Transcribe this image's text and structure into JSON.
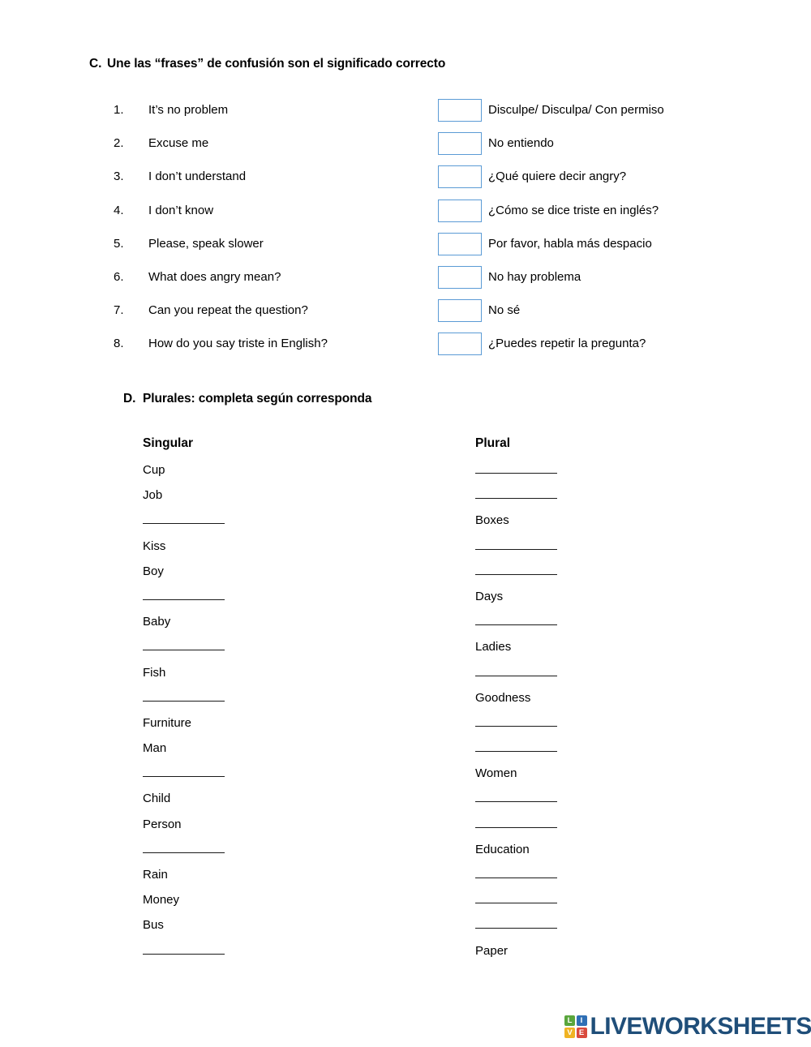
{
  "section_c": {
    "letter": "C.",
    "title": "Une las “frases” de confusión son el significado correcto",
    "items": [
      {
        "num": "1.",
        "english": "It’s no problem",
        "spanish": "Disculpe/ Disculpa/ Con permiso"
      },
      {
        "num": "2.",
        "english": "Excuse me",
        "spanish": "No entiendo"
      },
      {
        "num": "3.",
        "english": "I don’t understand",
        "spanish": "¿Qué quiere decir angry?"
      },
      {
        "num": "4.",
        "english": "I don’t know",
        "spanish": "¿Cómo se dice triste en inglés?"
      },
      {
        "num": "5.",
        "english": "Please, speak slower",
        "spanish": "Por favor, habla más despacio"
      },
      {
        "num": "6.",
        "english": "What does angry mean?",
        "spanish": "No hay problema"
      },
      {
        "num": "7.",
        "english": "Can you repeat the question?",
        "spanish": "No sé"
      },
      {
        "num": "8.",
        "english": "How do you say triste in English?",
        "spanish": "¿Puedes repetir la pregunta?"
      }
    ],
    "answer_box_value": ""
  },
  "section_d": {
    "letter": "D.",
    "title": "Plurales: completa según corresponda",
    "columns": {
      "singular": "Singular",
      "plural": "Plural"
    },
    "rows": [
      {
        "singular": "Cup",
        "plural": ""
      },
      {
        "singular": "Job",
        "plural": ""
      },
      {
        "singular": "",
        "plural": "Boxes"
      },
      {
        "singular": "Kiss",
        "plural": ""
      },
      {
        "singular": "Boy",
        "plural": ""
      },
      {
        "singular": "",
        "plural": "Days"
      },
      {
        "singular": "Baby",
        "plural": ""
      },
      {
        "singular": "",
        "plural": "Ladies"
      },
      {
        "singular": "Fish",
        "plural": ""
      },
      {
        "singular": "",
        "plural": "Goodness"
      },
      {
        "singular": "Furniture",
        "plural": ""
      },
      {
        "singular": "Man",
        "plural": ""
      },
      {
        "singular": "",
        "plural": "Women"
      },
      {
        "singular": "Child",
        "plural": ""
      },
      {
        "singular": "Person",
        "plural": ""
      },
      {
        "singular": "",
        "plural": "Education"
      },
      {
        "singular": "Rain",
        "plural": ""
      },
      {
        "singular": "Money",
        "plural": ""
      },
      {
        "singular": "Bus",
        "plural": ""
      },
      {
        "singular": "",
        "plural": "Paper"
      }
    ]
  },
  "footer": {
    "logo_tiles": [
      {
        "letter": "L",
        "color": "#5aa63c"
      },
      {
        "letter": "I",
        "color": "#2f6fb5"
      },
      {
        "letter": "V",
        "color": "#f0b323"
      },
      {
        "letter": "E",
        "color": "#d94a3d"
      }
    ],
    "wordmark": "LIVEWORKSHEETS",
    "wordmark_color": "#1f4e79"
  }
}
